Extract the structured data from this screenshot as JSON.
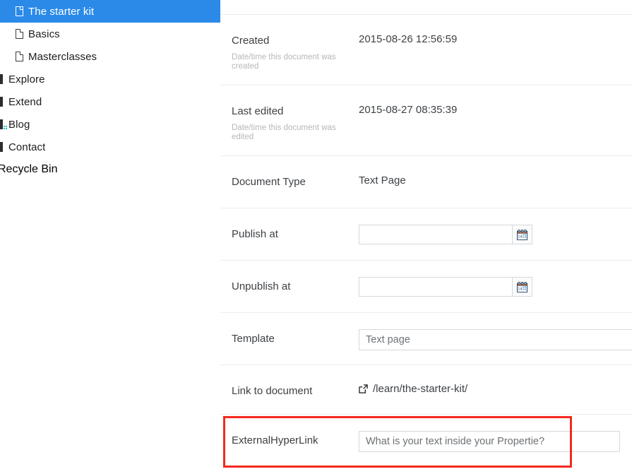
{
  "sidebar": {
    "items": [
      {
        "label": "The starter kit",
        "icon": "document-icon",
        "level": 2,
        "selected": true
      },
      {
        "label": "Basics",
        "icon": "document-icon",
        "level": 2,
        "selected": false
      },
      {
        "label": "Masterclasses",
        "icon": "document-icon",
        "level": 2,
        "selected": false
      },
      {
        "label": "Explore",
        "icon": "content-node-icon",
        "level": 1,
        "selected": false
      },
      {
        "label": "Extend",
        "icon": "content-node-icon",
        "level": 1,
        "selected": false
      },
      {
        "label": "Blog",
        "icon": "content-node-blog-icon",
        "level": 1,
        "selected": false
      },
      {
        "label": "Contact",
        "icon": "content-node-icon",
        "level": 1,
        "selected": false
      }
    ],
    "recycle_bin_label": "Recycle Bin",
    "selected_color": "#2b8ae8"
  },
  "properties": {
    "created": {
      "label": "Created",
      "description": "Date/time this document was created",
      "value": "2015-08-26 12:56:59"
    },
    "last_edited": {
      "label": "Last edited",
      "description": "Date/time this document was edited",
      "value": "2015-08-27 08:35:39"
    },
    "document_type": {
      "label": "Document Type",
      "value": "Text Page"
    },
    "publish_at": {
      "label": "Publish at",
      "value": "",
      "placeholder": "",
      "calendar_icon": "calendar-icon",
      "calendar_day": "14"
    },
    "unpublish_at": {
      "label": "Unpublish at",
      "value": "",
      "placeholder": "",
      "calendar_icon": "calendar-icon",
      "calendar_day": "14"
    },
    "template": {
      "label": "Template",
      "selected_option": "Text page"
    },
    "link_to_document": {
      "label": "Link to document",
      "icon": "external-link-icon",
      "url_text": "/learn/the-starter-kit/"
    },
    "external_hyperlink": {
      "label": "ExternalHyperLink",
      "value": "",
      "placeholder": "What is your text inside your Propertie?"
    }
  },
  "annotation": {
    "color": "#f5291f"
  }
}
